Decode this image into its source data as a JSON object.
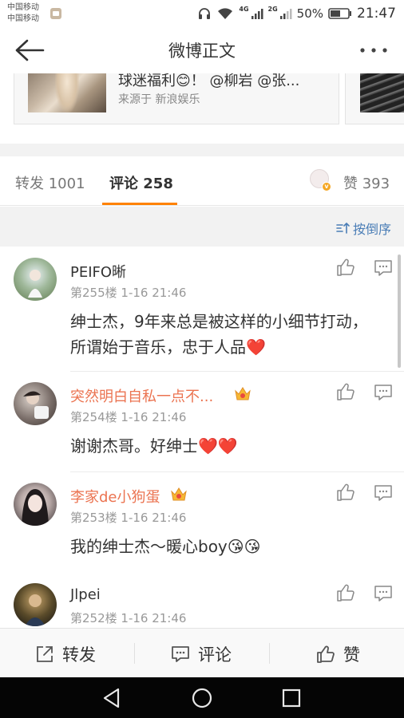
{
  "status_bar": {
    "carrier_1": "中国移动",
    "carrier_2": "中国移动",
    "network_1": "4G",
    "network_2": "2G",
    "battery": "50%",
    "time": "21:47"
  },
  "nav": {
    "title": "微博正文",
    "back_icon": "arrow-left-icon",
    "more_icon": "more-dots-icon"
  },
  "card": {
    "title": "球迷福利😊！ @柳岩 @张...",
    "source": "来源于 新浪娱乐"
  },
  "tabs": {
    "repost": "转发 1001",
    "comment": "评论 258",
    "like": "赞 393"
  },
  "sort": {
    "label": "按倒序"
  },
  "comments": [
    {
      "name": "PEIFO晰",
      "meta": "第255楼  1-16 21:46",
      "text": "绅士杰，9年来总是被这样的小细节打动，所谓始于音乐，忠于人品❤️",
      "vip": false
    },
    {
      "name": "突然明白自私一点不...",
      "meta": "第254楼  1-16 21:46",
      "text": "谢谢杰哥。好绅士❤️❤️",
      "vip": true
    },
    {
      "name": "李家de小狗蛋",
      "meta": "第253楼  1-16 21:46",
      "text": "我的绅士杰～暖心boy😘😘",
      "vip": true
    },
    {
      "name": "Jlpei",
      "meta": "第252楼  1-16 21:46",
      "text": "",
      "vip": false
    }
  ],
  "actions": {
    "repost": "转发",
    "comment": "评论",
    "like": "赞"
  },
  "colors": {
    "accent": "#ff8200",
    "vip_name": "#eb7350",
    "link": "#4a7db6"
  }
}
